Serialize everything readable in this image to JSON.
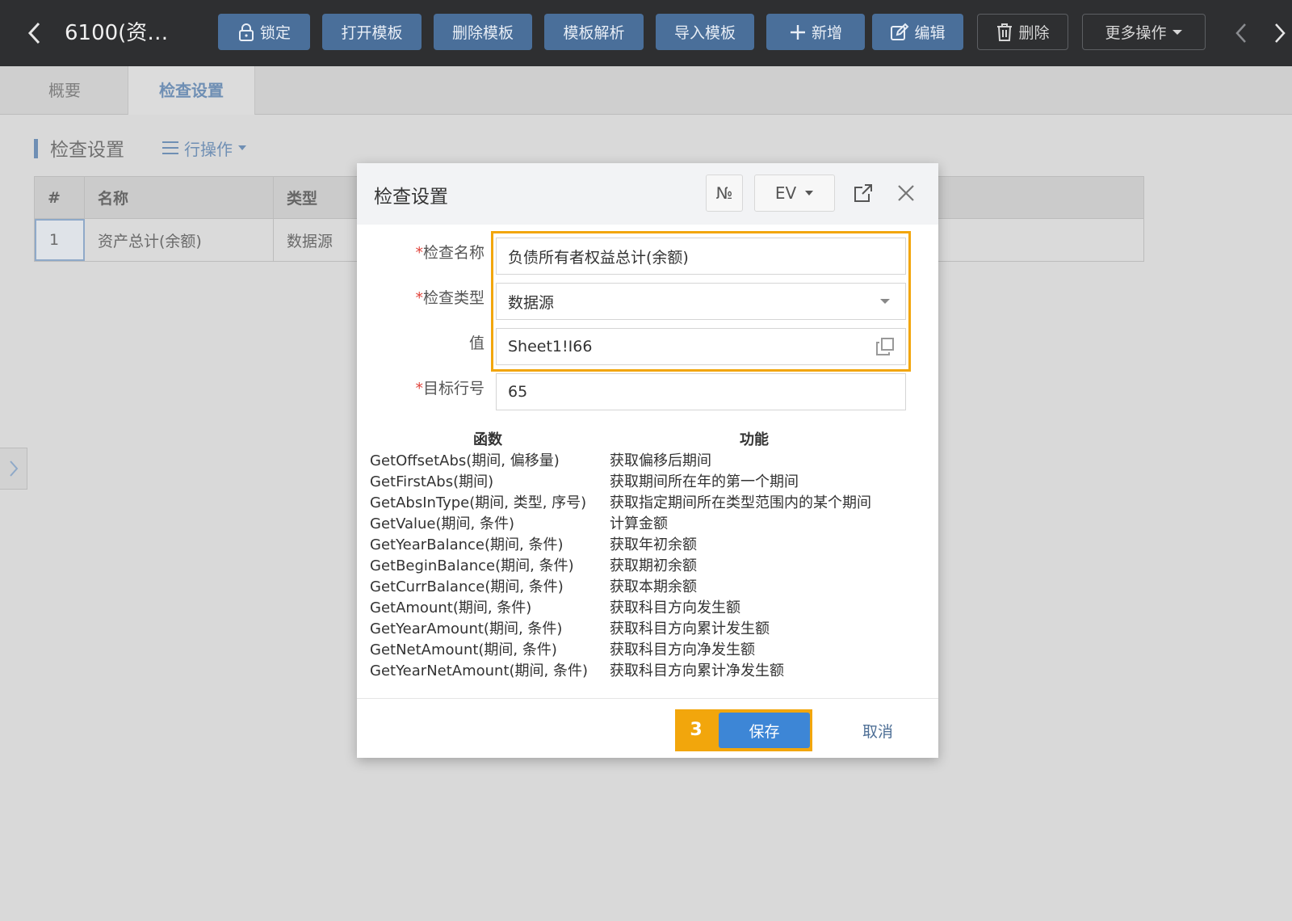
{
  "toolbar": {
    "title": "6100(资…",
    "buttons": {
      "lock": "锁定",
      "open_template": "打开模板",
      "delete_template": "删除模板",
      "parse_template": "模板解析",
      "import_template": "导入模板",
      "add": "新增",
      "edit": "编辑",
      "delete": "删除",
      "more": "更多操作"
    }
  },
  "tabs": [
    "概要",
    "检查设置"
  ],
  "section": {
    "title": "检查设置",
    "row_ops": "行操作"
  },
  "table": {
    "headers": [
      "#",
      "名称",
      "类型"
    ],
    "rows": [
      {
        "num": "1",
        "name": "资产总计(余额)",
        "type": "数据源"
      }
    ]
  },
  "dialog": {
    "title": "检查设置",
    "header_buttons": {
      "no": "№",
      "ev": "EV"
    },
    "form": {
      "name": {
        "label": "检查名称",
        "value": "负债所有者权益总计(余额)"
      },
      "type": {
        "label": "检查类型",
        "value": "数据源"
      },
      "value": {
        "label": "值",
        "value": "Sheet1!I66"
      },
      "target_row": {
        "label": "目标行号",
        "value": "65"
      }
    },
    "function_table": {
      "headers": {
        "function": "函数",
        "purpose": "功能"
      },
      "rows": [
        {
          "fn": "GetOffsetAbs(期间, 偏移量)",
          "desc": "获取偏移后期间"
        },
        {
          "fn": "GetFirstAbs(期间)",
          "desc": "获取期间所在年的第一个期间"
        },
        {
          "fn": "GetAbsInType(期间, 类型, 序号)",
          "desc": "获取指定期间所在类型范围内的某个期间"
        },
        {
          "fn": "GetValue(期间, 条件)",
          "desc": "计算金额"
        },
        {
          "fn": "GetYearBalance(期间, 条件)",
          "desc": "获取年初余额"
        },
        {
          "fn": "GetBeginBalance(期间, 条件)",
          "desc": "获取期初余额"
        },
        {
          "fn": "GetCurrBalance(期间, 条件)",
          "desc": "获取本期余额"
        },
        {
          "fn": "GetAmount(期间, 条件)",
          "desc": "获取科目方向发生额"
        },
        {
          "fn": "GetYearAmount(期间, 条件)",
          "desc": "获取科目方向累计发生额"
        },
        {
          "fn": "GetNetAmount(期间, 条件)",
          "desc": "获取科目方向净发生额"
        },
        {
          "fn": "GetYearNetAmount(期间, 条件)",
          "desc": "获取科目方向累计净发生额"
        }
      ]
    },
    "footer": {
      "step": "3",
      "save": "保存",
      "cancel": "取消"
    }
  },
  "colors": {
    "toolbar_bg": "#2e2f31",
    "toolbar_button": "#4a6f9a",
    "accent": "#6f8fb4",
    "highlight": "#f2a60c",
    "primary_button": "#3d86d6",
    "required": "#e0443c"
  }
}
